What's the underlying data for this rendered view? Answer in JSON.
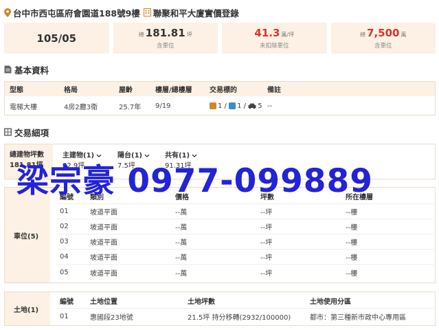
{
  "header": {
    "address": "台中市西屯區府會園道188號9樓",
    "building": "聯聚和平大廈實價登錄"
  },
  "stats": {
    "date": "105/05",
    "total_area": {
      "prefix": "總",
      "value": "181.81",
      "unit": "坪",
      "sub": "含車位"
    },
    "unit_price": {
      "value": "41.3",
      "unit": "萬/坪",
      "sub": "未扣除車位"
    },
    "total_price": {
      "prefix": "總",
      "value": "7,500",
      "unit": "萬",
      "sub": "含車位"
    }
  },
  "basic": {
    "title": "基本資料",
    "headers": [
      "型態",
      "格局",
      "屋齡",
      "樓層/總樓層",
      "交易標的",
      "備註"
    ],
    "values": {
      "type": "電梯大樓",
      "layout": "4房2廳3衛",
      "age": "25.7年",
      "floor": "9/19",
      "land_count": "1",
      "building_count": "1",
      "car_count": "5",
      "note": "--"
    }
  },
  "detail": {
    "title": "交易細項",
    "total_label": "總建物坪數",
    "total_value": "181.81坪",
    "main": {
      "label": "主建物(1)",
      "value": "82.9坪"
    },
    "balcony": {
      "label": "陽台(1)",
      "value": "7.5坪"
    },
    "common": {
      "label": "共有(1)",
      "value": "91.31坪"
    }
  },
  "overlay_text": "梁宗豪  0977-099889",
  "parking": {
    "label": "車位(5)",
    "headers": [
      "編號",
      "類別",
      "價格",
      "坪數",
      "所在樓層"
    ],
    "rows": [
      {
        "no": "01",
        "type": "坡道平面",
        "price": "--萬",
        "area": "--坪",
        "floor": "--樓"
      },
      {
        "no": "02",
        "type": "坡道平面",
        "price": "--萬",
        "area": "--坪",
        "floor": "--樓"
      },
      {
        "no": "03",
        "type": "坡道平面",
        "price": "--萬",
        "area": "--坪",
        "floor": "--樓"
      },
      {
        "no": "04",
        "type": "坡道平面",
        "price": "--萬",
        "area": "--坪",
        "floor": "--樓"
      },
      {
        "no": "05",
        "type": "坡道平面",
        "price": "--萬",
        "area": "--坪",
        "floor": "--樓"
      }
    ]
  },
  "land": {
    "label": "土地(1)",
    "headers": [
      "編號",
      "土地位置",
      "土地坪數",
      "土地使用分區"
    ],
    "row": {
      "no": "01",
      "location": "惠國段23地號",
      "area": "21.5坪 持分移轉(2932/100000)",
      "zone": "都市：第三種新市政中心專用區"
    }
  },
  "colors": {
    "accent_bg": "#fcf1e4",
    "price_red": "#d9342b",
    "overlay_blue": "#2323d8",
    "land_tag": "#c98a2b",
    "building_tag": "#3a8fc9"
  }
}
